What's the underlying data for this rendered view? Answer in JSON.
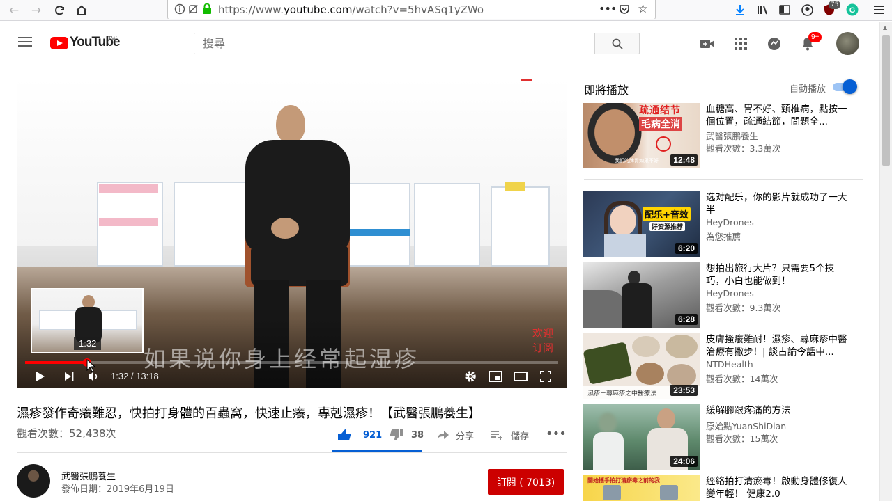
{
  "browser": {
    "url_prefix": "https://www.",
    "url_domain": "youtube.com",
    "url_rest": "/watch?v=5hvASq1yZWo",
    "ext_badge": "75"
  },
  "header": {
    "logo_text": "YouTube",
    "logo_region": "TW",
    "search_placeholder": "搜尋",
    "notif_count": "9+"
  },
  "player": {
    "subtitle": "如果说你身上经常起湿疹",
    "welcome_line1": "欢迎",
    "welcome_line2": "订阅",
    "preview_time": "1:32",
    "time_display": "1:32 / 13:18",
    "progress": 0.116
  },
  "video": {
    "title": "濕疹發作奇癢難忍，快拍打身體的百蟲窩，快速止癢，專剋濕疹！【武醫張鵬養生】",
    "views": "觀看次數：52,438次",
    "likes": "921",
    "dislikes": "38",
    "share": "分享",
    "save": "儲存"
  },
  "channel": {
    "name": "武醫張鵬養生",
    "date": "發佈日期：2019年6月19日",
    "subscribe": "訂閱 ( 7013)"
  },
  "sidebar": {
    "upnext": "即將播放",
    "autoplay": "自動播放",
    "recs": [
      {
        "title": "血糖高、胃不好、頸椎病，點按一個位置，疏通結節，問題全...",
        "channel": "武醫張鵬養生",
        "meta": "觀看次數：3.3萬次",
        "duration": "12:48",
        "overlay1": "疏通结节",
        "overlay2": "毛病全消",
        "overlay3": "我们的脾胃如果不好"
      },
      {
        "title": "选对配乐，你的影片就成功了一大半",
        "channel": "HeyDrones",
        "meta": "為您推薦",
        "duration": "6:20",
        "overlay1": "配乐+音效",
        "overlay2": "好资源推荐"
      },
      {
        "title": "想拍出旅行大片？只需要5个技巧，小白也能做到！",
        "channel": "HeyDrones",
        "meta": "觀看次數：9.3萬次",
        "duration": "6:28"
      },
      {
        "title": "皮膚搔癢難耐！濕疹、蕁麻疹中醫治療有撇步！| 談古論今話中...",
        "channel": "NTDHealth",
        "meta": "觀看次數：14萬次",
        "duration": "23:53",
        "overlay1": "濕疹＋蕁麻疹之中醫療法"
      },
      {
        "title": "緩解腳跟疼痛的方法",
        "channel": "原始點YuanShiDian",
        "meta": "觀看次數：15萬次",
        "duration": "24:06"
      },
      {
        "title": "經絡拍打清瘀毒！啟動身體修復人變年輕！ 健康2.0",
        "channel": "",
        "meta": "",
        "duration": "",
        "overlay1": "開始攜手拍打清瘀毒之前的我"
      }
    ]
  },
  "colors": {
    "brand_red": "#ff0000",
    "accent_blue": "#065fd4",
    "subscribe_red": "#cc0000"
  }
}
